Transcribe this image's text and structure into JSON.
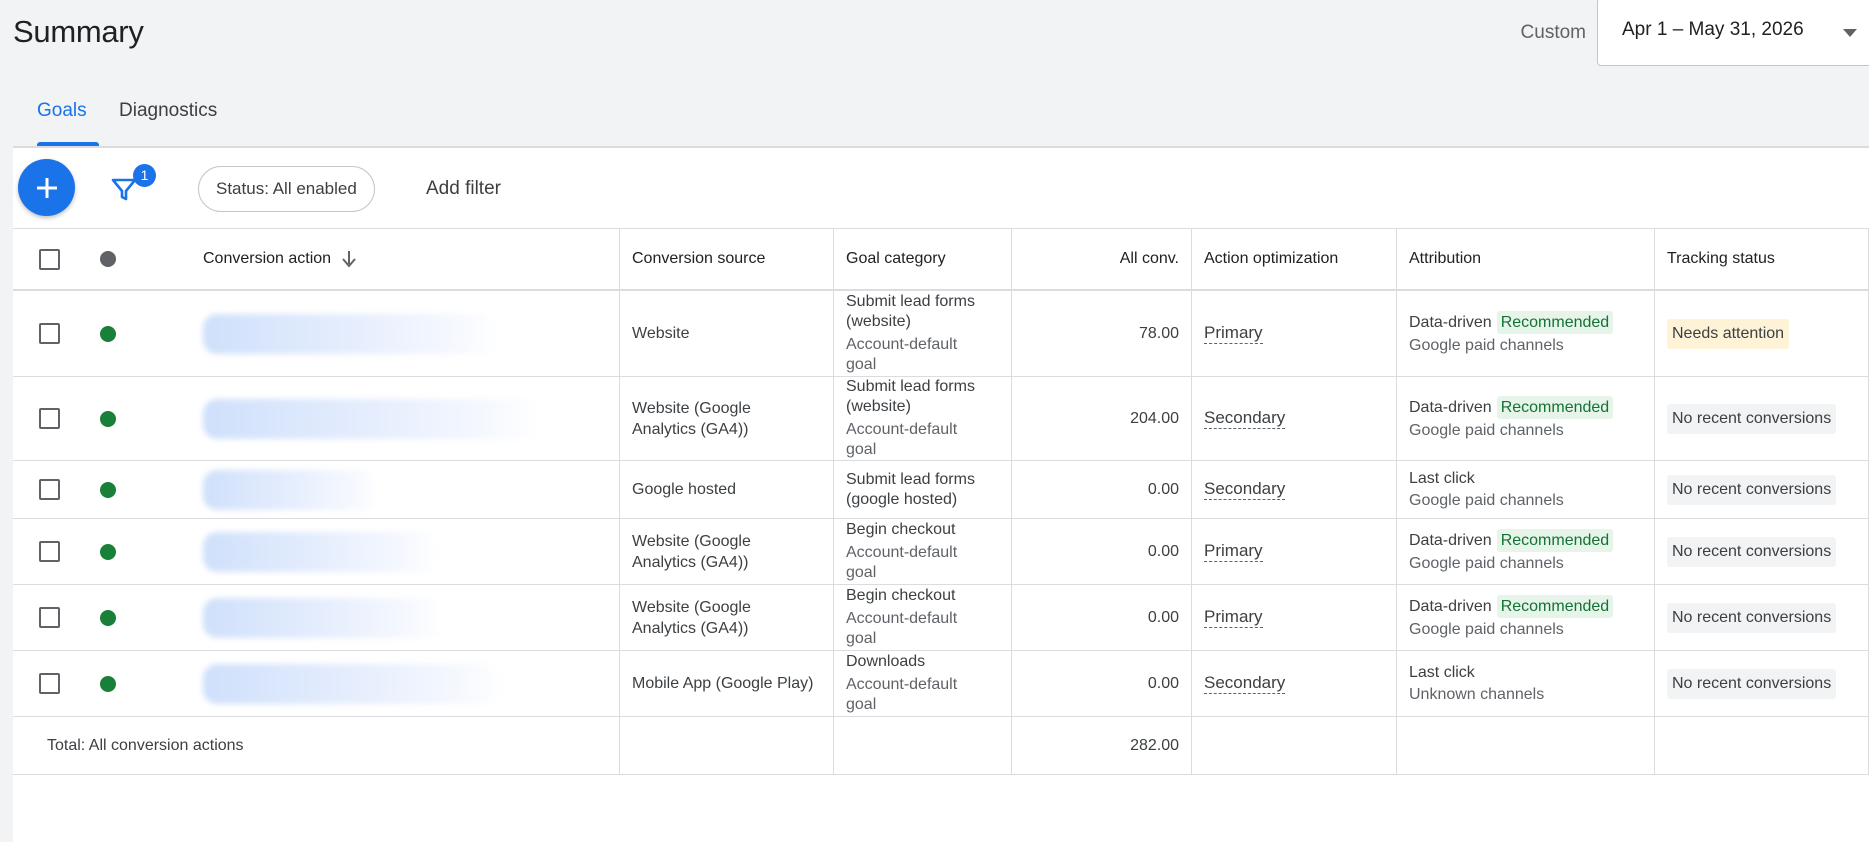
{
  "header": {
    "title": "Summary",
    "date_preset": "Custom",
    "date_range": "Apr 1 – May 31, 2026"
  },
  "tabs": [
    {
      "label": "Goals",
      "active": true
    },
    {
      "label": "Diagnostics",
      "active": false
    }
  ],
  "toolbar": {
    "filter_count": "1",
    "status_chip": "Status: All enabled",
    "add_filter": "Add filter"
  },
  "columns": {
    "conversion_action": "Conversion action",
    "conversion_source": "Conversion source",
    "goal_category": "Goal category",
    "all_conv": "All conv.",
    "action_optimization": "Action optimization",
    "attribution": "Attribution",
    "tracking_status": "Tracking status"
  },
  "rows": [
    {
      "source": [
        "Website"
      ],
      "goal_title": [
        "Submit lead forms",
        "(website)"
      ],
      "goal_sub": [
        "Account-default",
        "goal"
      ],
      "all_conv": "78.00",
      "optimization": "Primary",
      "attribution_model": "Data-driven",
      "recommended": "Recommended",
      "attribution_channels": "Google paid channels",
      "tracking_status": "Needs attention",
      "status_kind": "warn"
    },
    {
      "source": [
        "Website (Google",
        "Analytics (GA4))"
      ],
      "goal_title": [
        "Submit lead forms",
        "(website)"
      ],
      "goal_sub": [
        "Account-default",
        "goal"
      ],
      "all_conv": "204.00",
      "optimization": "Secondary",
      "attribution_model": "Data-driven",
      "recommended": "Recommended",
      "attribution_channels": "Google paid channels",
      "tracking_status": "No recent conversions",
      "status_kind": "neutral"
    },
    {
      "source": [
        "Google hosted"
      ],
      "goal_title": [
        "Submit lead forms",
        "(google hosted)"
      ],
      "goal_sub": [],
      "all_conv": "0.00",
      "optimization": "Secondary",
      "attribution_model": "Last click",
      "recommended": "",
      "attribution_channels": "Google paid channels",
      "tracking_status": "No recent conversions",
      "status_kind": "neutral"
    },
    {
      "source": [
        "Website (Google",
        "Analytics (GA4))"
      ],
      "goal_title": [
        "Begin checkout"
      ],
      "goal_sub": [
        "Account-default",
        "goal"
      ],
      "all_conv": "0.00",
      "optimization": "Primary",
      "attribution_model": "Data-driven",
      "recommended": "Recommended",
      "attribution_channels": "Google paid channels",
      "tracking_status": "No recent conversions",
      "status_kind": "neutral"
    },
    {
      "source": [
        "Website (Google",
        "Analytics (GA4))"
      ],
      "goal_title": [
        "Begin checkout"
      ],
      "goal_sub": [
        "Account-default",
        "goal"
      ],
      "all_conv": "0.00",
      "optimization": "Primary",
      "attribution_model": "Data-driven",
      "recommended": "Recommended",
      "attribution_channels": "Google paid channels",
      "tracking_status": "No recent conversions",
      "status_kind": "neutral"
    },
    {
      "source": [
        "Mobile App (Google Play)"
      ],
      "goal_title": [
        "Downloads"
      ],
      "goal_sub": [
        "Account-default",
        "goal"
      ],
      "all_conv": "0.00",
      "optimization": "Secondary",
      "attribution_model": "Last click",
      "recommended": "",
      "attribution_channels": "Unknown channels",
      "tracking_status": "No recent conversions",
      "status_kind": "neutral"
    }
  ],
  "total": {
    "label": "Total: All conversion actions",
    "all_conv": "282.00"
  },
  "icons": {
    "add": "plus-icon",
    "filter": "filter-icon",
    "sort": "arrow-down-icon",
    "dropdown": "caret-down-icon"
  },
  "colors": {
    "accent": "#1a73e8",
    "enabled": "#188038",
    "recommended_bg": "#e6f4ea",
    "recommended_text": "#137333",
    "warning_bg": "#fef3d7"
  }
}
